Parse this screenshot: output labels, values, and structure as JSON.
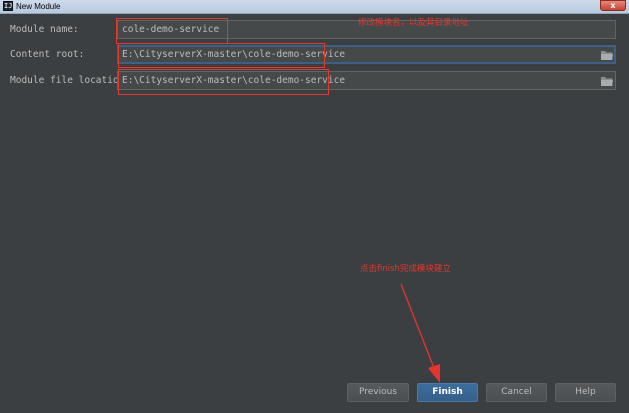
{
  "window": {
    "title": "New Module",
    "icon_glyph": "IJ",
    "close_glyph": "x"
  },
  "form": {
    "module_name": {
      "label": "Module name:",
      "value": "cole-demo-service"
    },
    "content_root": {
      "label": "Content root:",
      "value": "E:\\CityserverX-master\\cole-demo-service"
    },
    "module_file_location": {
      "label": "Module file location:",
      "value": "E:\\CityserverX-master\\cole-demo-service"
    }
  },
  "annotations": {
    "top_note": "修改模块名，以及其目录地址",
    "bottom_note": "点击finish完成模块建立"
  },
  "buttons": {
    "previous": "Previous",
    "finish": "Finish",
    "cancel": "Cancel",
    "help": "Help"
  },
  "colors": {
    "background": "#3c3f41",
    "annotation_red": "#e8342a",
    "primary_button": "#365f89"
  }
}
